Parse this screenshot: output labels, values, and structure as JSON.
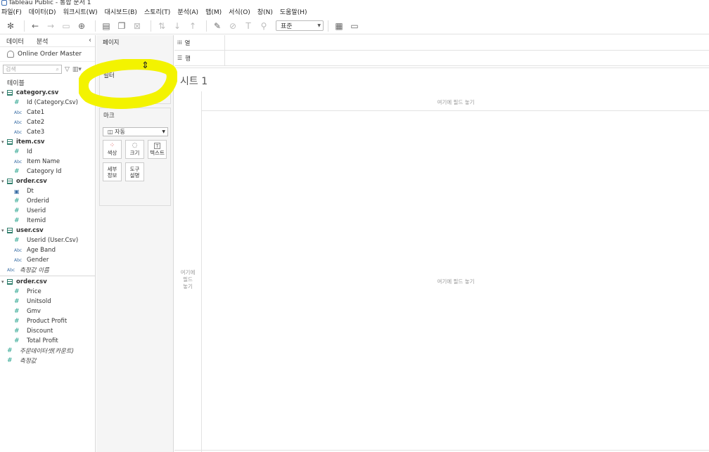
{
  "window": {
    "title": "Tableau Public - 통합 문서 1"
  },
  "menu": [
    "파일(F)",
    "데이터(D)",
    "워크시트(W)",
    "대시보드(B)",
    "스토리(T)",
    "분석(A)",
    "맵(M)",
    "서식(O)",
    "창(N)",
    "도움말(H)"
  ],
  "toolbar": {
    "fit_value": "표준"
  },
  "left_pane": {
    "tabs": [
      "데이터",
      "분석"
    ],
    "datasource": "Online Order Master",
    "search_placeholder": "검색",
    "tables_heading": "테이블",
    "tables": [
      {
        "name": "category.csv",
        "fields": [
          {
            "type": "num",
            "name": "Id (Category.Csv)"
          },
          {
            "type": "abc",
            "name": "Cate1"
          },
          {
            "type": "abc",
            "name": "Cate2"
          },
          {
            "type": "abc",
            "name": "Cate3"
          }
        ]
      },
      {
        "name": "item.csv",
        "fields": [
          {
            "type": "num",
            "name": "Id"
          },
          {
            "type": "abc",
            "name": "Item Name"
          },
          {
            "type": "num",
            "name": "Category Id"
          }
        ]
      },
      {
        "name": "order.csv",
        "fields": [
          {
            "type": "date",
            "name": "Dt"
          },
          {
            "type": "num",
            "name": "Orderid"
          },
          {
            "type": "num",
            "name": "Userid"
          },
          {
            "type": "num",
            "name": "Itemid"
          }
        ]
      },
      {
        "name": "user.csv",
        "fields": [
          {
            "type": "num",
            "name": "Userid (User.Csv)"
          },
          {
            "type": "abc",
            "name": "Age Band"
          },
          {
            "type": "abc",
            "name": "Gender"
          }
        ]
      }
    ],
    "measure_names": "측정값 이름",
    "measure_table": {
      "name": "order.csv",
      "fields": [
        "Price",
        "Unitsold",
        "Gmv",
        "Product Profit",
        "Discount",
        "Total Profit"
      ]
    },
    "extra_measures": [
      "주문데이터셋(카운트)",
      "측정값"
    ]
  },
  "cards": {
    "pages": "페이지",
    "filters": "필터",
    "marks": "마크",
    "marks_type": "자동",
    "mark_buttons": [
      {
        "icon": "⁘",
        "label": "색상"
      },
      {
        "icon": "◌",
        "label": "크기"
      },
      {
        "icon": "T",
        "label": "텍스트"
      }
    ],
    "mark_buttons2": [
      {
        "l1": "세부",
        "l2": "정보"
      },
      {
        "l1": "도구",
        "l2": "설명"
      }
    ]
  },
  "shelves": {
    "columns": "열",
    "rows": "행"
  },
  "canvas": {
    "sheet_title": "시트 1",
    "drop_top": "여기에 필드 놓기",
    "drop_left": [
      "여기에",
      "필드",
      "놓기"
    ],
    "drop_center": "여기에 필드 놓기"
  },
  "annotation": {
    "highlight_color": "#f3f300"
  }
}
